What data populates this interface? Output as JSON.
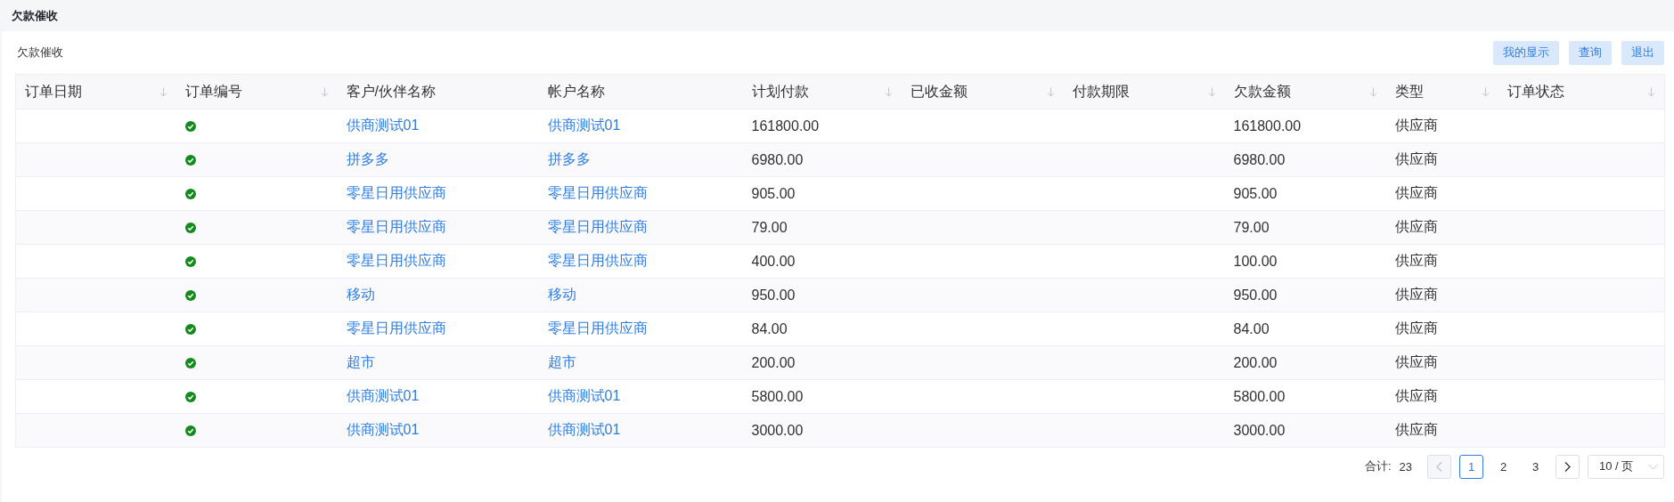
{
  "page_title": "欠款催收",
  "panel": {
    "title": "欠款催收",
    "buttons": [
      "我的显示",
      "查询",
      "退出"
    ]
  },
  "table": {
    "columns": [
      {
        "label": "订单日期",
        "sortable": true
      },
      {
        "label": "订单编号",
        "sortable": true
      },
      {
        "label": "客户/伙伴名称",
        "sortable": false
      },
      {
        "label": "帐户名称",
        "sortable": false
      },
      {
        "label": "计划付款",
        "sortable": true
      },
      {
        "label": "已收金额",
        "sortable": true
      },
      {
        "label": "付款期限",
        "sortable": true
      },
      {
        "label": "欠款金额",
        "sortable": true
      },
      {
        "label": "类型",
        "sortable": true
      },
      {
        "label": "订单状态",
        "sortable": true
      }
    ],
    "rows": [
      {
        "verified": true,
        "customer": "供商测试01",
        "account": "供商测试01",
        "planned": "161800.00",
        "owed": "161800.00",
        "type": "供应商"
      },
      {
        "verified": true,
        "customer": "拼多多",
        "account": "拼多多",
        "planned": "6980.00",
        "owed": "6980.00",
        "type": "供应商"
      },
      {
        "verified": true,
        "customer": "零星日用供应商",
        "account": "零星日用供应商",
        "planned": "905.00",
        "owed": "905.00",
        "type": "供应商"
      },
      {
        "verified": true,
        "customer": "零星日用供应商",
        "account": "零星日用供应商",
        "planned": "79.00",
        "owed": "79.00",
        "type": "供应商"
      },
      {
        "verified": true,
        "customer": "零星日用供应商",
        "account": "零星日用供应商",
        "planned": "400.00",
        "owed": "100.00",
        "type": "供应商"
      },
      {
        "verified": true,
        "customer": "移动",
        "account": "移动",
        "planned": "950.00",
        "owed": "950.00",
        "type": "供应商"
      },
      {
        "verified": true,
        "customer": "零星日用供应商",
        "account": "零星日用供应商",
        "planned": "84.00",
        "owed": "84.00",
        "type": "供应商"
      },
      {
        "verified": true,
        "customer": "超市",
        "account": "超市",
        "planned": "200.00",
        "owed": "200.00",
        "type": "供应商"
      },
      {
        "verified": true,
        "customer": "供商测试01",
        "account": "供商测试01",
        "planned": "5800.00",
        "owed": "5800.00",
        "type": "供应商"
      },
      {
        "verified": true,
        "customer": "供商测试01",
        "account": "供商测试01",
        "planned": "3000.00",
        "owed": "3000.00",
        "type": "供应商"
      }
    ]
  },
  "pagination": {
    "total_label": "合计:",
    "total": "23",
    "prev_disabled": true,
    "next_disabled": false,
    "pages": [
      {
        "label": "1",
        "selected": true
      },
      {
        "label": "2",
        "selected": false
      },
      {
        "label": "3",
        "selected": false
      }
    ],
    "page_size": "10 / 页"
  }
}
